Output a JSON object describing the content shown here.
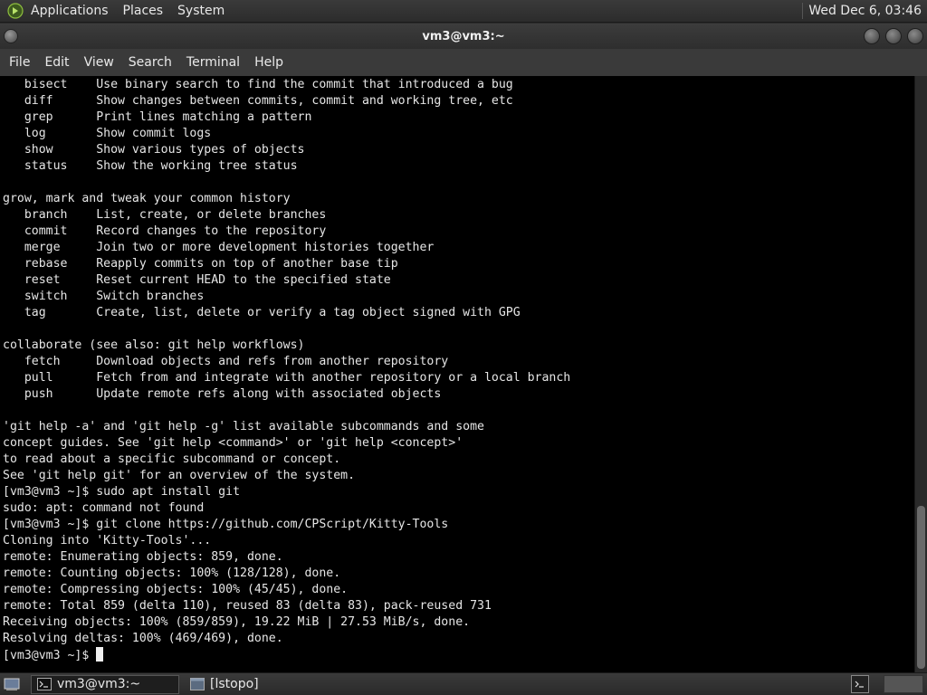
{
  "top_panel": {
    "menus": [
      "Applications",
      "Places",
      "System"
    ],
    "clock": "Wed Dec  6, 03:46"
  },
  "window": {
    "title": "vm3@vm3:~"
  },
  "menubar": {
    "items": [
      "File",
      "Edit",
      "View",
      "Search",
      "Terminal",
      "Help"
    ]
  },
  "terminal": {
    "lines": [
      "   bisect    Use binary search to find the commit that introduced a bug",
      "   diff      Show changes between commits, commit and working tree, etc",
      "   grep      Print lines matching a pattern",
      "   log       Show commit logs",
      "   show      Show various types of objects",
      "   status    Show the working tree status",
      "",
      "grow, mark and tweak your common history",
      "   branch    List, create, or delete branches",
      "   commit    Record changes to the repository",
      "   merge     Join two or more development histories together",
      "   rebase    Reapply commits on top of another base tip",
      "   reset     Reset current HEAD to the specified state",
      "   switch    Switch branches",
      "   tag       Create, list, delete or verify a tag object signed with GPG",
      "",
      "collaborate (see also: git help workflows)",
      "   fetch     Download objects and refs from another repository",
      "   pull      Fetch from and integrate with another repository or a local branch",
      "   push      Update remote refs along with associated objects",
      "",
      "'git help -a' and 'git help -g' list available subcommands and some",
      "concept guides. See 'git help <command>' or 'git help <concept>'",
      "to read about a specific subcommand or concept.",
      "See 'git help git' for an overview of the system.",
      "[vm3@vm3 ~]$ sudo apt install git",
      "sudo: apt: command not found",
      "[vm3@vm3 ~]$ git clone https://github.com/CPScript/Kitty-Tools",
      "Cloning into 'Kitty-Tools'...",
      "remote: Enumerating objects: 859, done.",
      "remote: Counting objects: 100% (128/128), done.",
      "remote: Compressing objects: 100% (45/45), done.",
      "remote: Total 859 (delta 110), reused 83 (delta 83), pack-reused 731",
      "Receiving objects: 100% (859/859), 19.22 MiB | 27.53 MiB/s, done.",
      "Resolving deltas: 100% (469/469), done."
    ],
    "prompt": "[vm3@vm3 ~]$ "
  },
  "taskbar": {
    "tasks": [
      {
        "label": "vm3@vm3:~",
        "icon": "terminal-icon",
        "active": true
      },
      {
        "label": "[lstopo]",
        "icon": "window-icon",
        "active": false
      }
    ]
  }
}
